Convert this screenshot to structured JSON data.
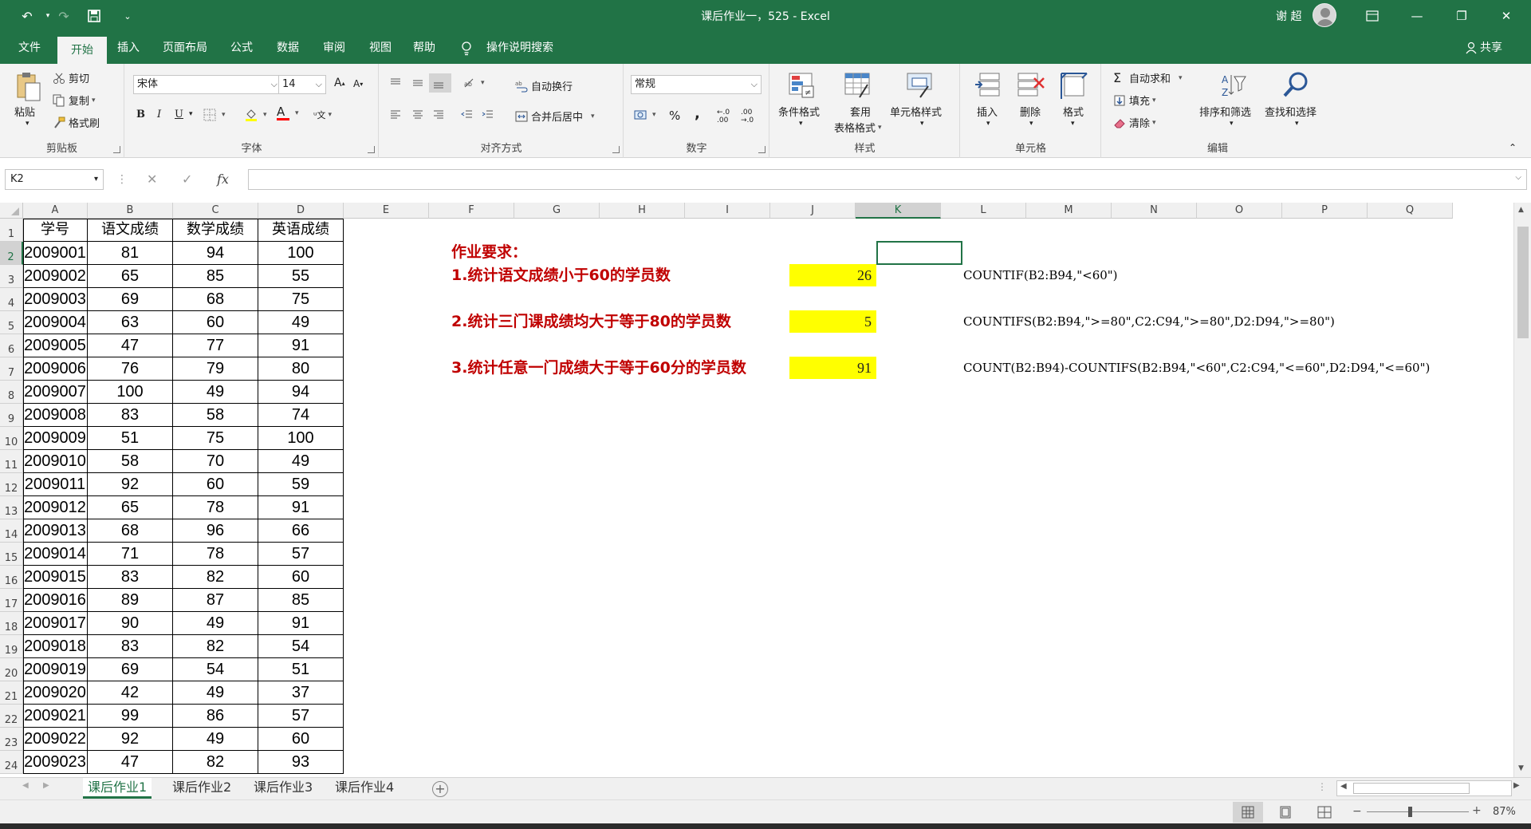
{
  "window": {
    "title": "课后作业一，525  -  Excel",
    "user": "谢 超"
  },
  "menu": {
    "file": "文件",
    "tabs": [
      "开始",
      "插入",
      "页面布局",
      "公式",
      "数据",
      "审阅",
      "视图",
      "帮助"
    ],
    "search": "操作说明搜索",
    "share": "共享"
  },
  "ribbon": {
    "clipboard": {
      "label": "剪贴板",
      "paste": "粘贴",
      "cut": "剪切",
      "copy": "复制",
      "painter": "格式刷"
    },
    "font": {
      "label": "字体",
      "name": "宋体",
      "size": "14",
      "bold": "B",
      "italic": "I",
      "underline": "U",
      "grow": "A",
      "shrink": "A"
    },
    "alignment": {
      "label": "对齐方式",
      "wrap": "自动换行",
      "merge": "合并后居中"
    },
    "number": {
      "label": "数字",
      "format": "常规",
      "percent": "%",
      "comma": ","
    },
    "styles": {
      "label": "样式",
      "conditional": "条件格式",
      "table_line1": "套用",
      "table_line2": "表格格式",
      "cell": "单元格样式"
    },
    "cells": {
      "label": "单元格",
      "insert": "插入",
      "delete": "删除",
      "format": "格式"
    },
    "editing": {
      "label": "编辑",
      "autosum": "自动求和",
      "fill": "填充",
      "clear": "清除",
      "sort": "排序和筛选",
      "find": "查找和选择"
    }
  },
  "formula_bar": {
    "name_box": "K2",
    "fx": "fx",
    "formula": ""
  },
  "grid": {
    "columns": [
      "A",
      "B",
      "C",
      "D",
      "E",
      "F",
      "G",
      "H",
      "I",
      "J",
      "K",
      "L",
      "M",
      "N",
      "O",
      "P",
      "Q"
    ],
    "selected_column": "K",
    "rows": [
      "1",
      "2",
      "3",
      "4",
      "5",
      "6",
      "7",
      "8",
      "9",
      "10",
      "11",
      "12",
      "13",
      "14",
      "15",
      "16",
      "17",
      "18",
      "19",
      "20",
      "21",
      "22",
      "23",
      "24"
    ],
    "selected_row": "2",
    "header": [
      "学号",
      "语文成绩",
      "数学成绩",
      "英语成绩"
    ],
    "data": [
      [
        "2009001",
        "81",
        "94",
        "100"
      ],
      [
        "2009002",
        "65",
        "85",
        "55"
      ],
      [
        "2009003",
        "69",
        "68",
        "75"
      ],
      [
        "2009004",
        "63",
        "60",
        "49"
      ],
      [
        "2009005",
        "47",
        "77",
        "91"
      ],
      [
        "2009006",
        "76",
        "79",
        "80"
      ],
      [
        "2009007",
        "100",
        "49",
        "94"
      ],
      [
        "2009008",
        "83",
        "58",
        "74"
      ],
      [
        "2009009",
        "51",
        "75",
        "100"
      ],
      [
        "2009010",
        "58",
        "70",
        "49"
      ],
      [
        "2009011",
        "92",
        "60",
        "59"
      ],
      [
        "2009012",
        "65",
        "78",
        "91"
      ],
      [
        "2009013",
        "68",
        "96",
        "66"
      ],
      [
        "2009014",
        "71",
        "78",
        "57"
      ],
      [
        "2009015",
        "83",
        "82",
        "60"
      ],
      [
        "2009016",
        "89",
        "87",
        "85"
      ],
      [
        "2009017",
        "90",
        "49",
        "91"
      ],
      [
        "2009018",
        "83",
        "82",
        "54"
      ],
      [
        "2009019",
        "69",
        "54",
        "51"
      ],
      [
        "2009020",
        "42",
        "49",
        "37"
      ],
      [
        "2009021",
        "99",
        "86",
        "57"
      ],
      [
        "2009022",
        "92",
        "49",
        "60"
      ],
      [
        "2009023",
        "47",
        "82",
        "93"
      ]
    ],
    "assignment_title": "作业要求：",
    "tasks": [
      {
        "text": "1.统计语文成绩小于60的学员数",
        "result": "26",
        "formula": "COUNTIF(B2:B94,\"<60\")"
      },
      {
        "text": "2.统计三门课成绩均大于等于80的学员数",
        "result": "5",
        "formula": "COUNTIFS(B2:B94,\">=80\",C2:C94,\">=80\",D2:D94,\">=80\")"
      },
      {
        "text": "3.统计任意一门成绩大于等于60分的学员数",
        "result": "91",
        "formula": "COUNT(B2:B94)-COUNTIFS(B2:B94,\"<60\",C2:C94,\"<=60\",D2:D94,\"<=60\")"
      }
    ]
  },
  "sheets": [
    "课后作业1",
    "课后作业2",
    "课后作业3",
    "课后作业4"
  ],
  "status": {
    "zoom": "87%"
  },
  "colors": {
    "accent": "#217346",
    "highlight": "#ffff00",
    "task_text": "#c00000"
  }
}
